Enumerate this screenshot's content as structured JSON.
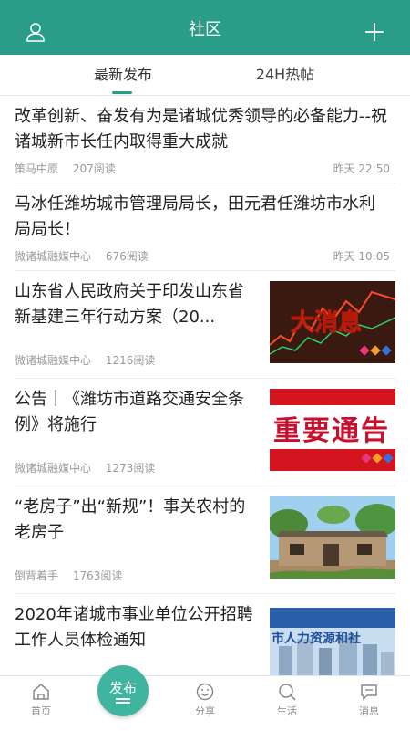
{
  "header": {
    "title": "社区",
    "left_icon": "user-icon",
    "right_icon": "plus-icon",
    "bg_color": "#2a9d88"
  },
  "tabs": [
    {
      "label": "最新发布",
      "active": true
    },
    {
      "label": "24H热帖",
      "active": false
    }
  ],
  "posts": [
    {
      "title": "改革创新、奋发有为是诸城优秀领导的必备能力--祝诸城新市长任内取得重大成就",
      "source": "策马中原",
      "reads": "207阅读",
      "time": "昨天 22:50"
    },
    {
      "title": "马冰任潍坊城市管理局局长，田元君任潍坊市水利局局长！",
      "source": "微诸城融媒中心",
      "reads": "676阅读",
      "time": "昨天 10:05"
    },
    {
      "title": "山东省人民政府关于印发山东省新基建三年行动方案（20...",
      "source": "微诸城融媒中心",
      "reads": "1216阅读",
      "thumb_text": "大消息"
    },
    {
      "title": "公告｜《潍坊市道路交通安全条例》将施行",
      "source": "微诸城融媒中心",
      "reads": "1273阅读",
      "thumb_text": "重要通告"
    },
    {
      "title": "“老房子”出“新规”！事关农村的老房子",
      "source": "倒背着手",
      "reads": "1763阅读"
    },
    {
      "title": "2020年诸城市事业单位公开招聘工作人员体检通知",
      "thumb_text": "市人力资源和社"
    }
  ],
  "bottom_nav": {
    "home": "首页",
    "publish": "发布",
    "share": "分享",
    "life": "生活",
    "messages": "消息"
  }
}
